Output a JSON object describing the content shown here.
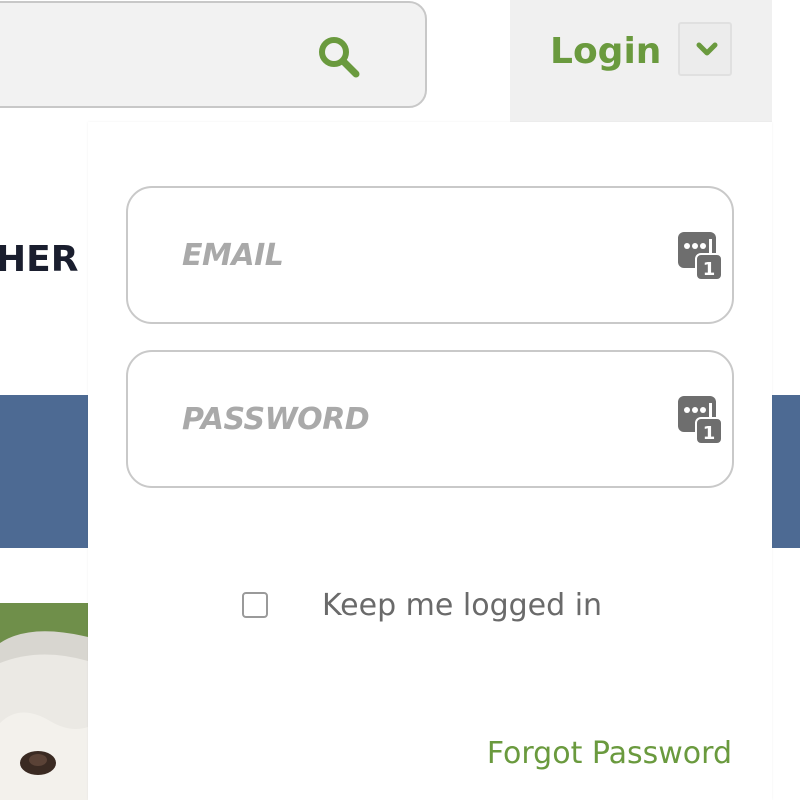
{
  "header": {
    "search": {
      "icon": "search-icon",
      "placeholder": ""
    },
    "login": {
      "label": "Login",
      "toggle_icon": "chevron-down-icon"
    }
  },
  "background": {
    "partial_heading": "HER S"
  },
  "login_form": {
    "email": {
      "placeholder": "EMAIL",
      "icon": "password-manager-icon",
      "icon_badge": "1"
    },
    "password": {
      "placeholder": "PASSWORD",
      "icon": "password-manager-icon",
      "icon_badge": "1"
    },
    "remember": {
      "label": "Keep me logged in",
      "checked": false
    },
    "forgot_link": "Forgot Password"
  },
  "colors": {
    "accent_green": "#6a9a3e",
    "band_blue": "#4d6a93",
    "field_border": "#c9c9c9",
    "placeholder_gray": "#a9a9a9"
  }
}
